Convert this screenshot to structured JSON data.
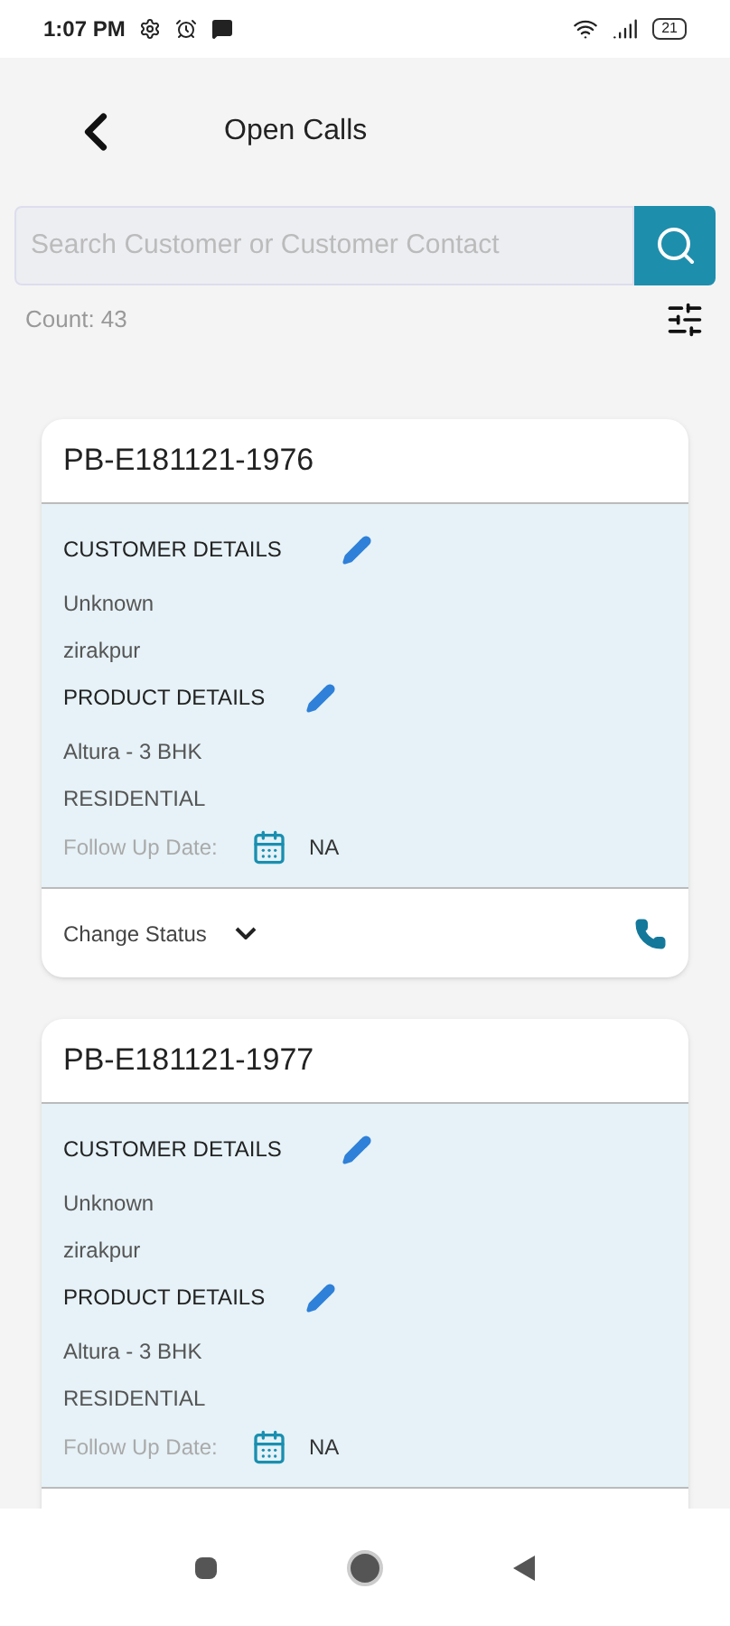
{
  "status_bar": {
    "time": "1:07 PM",
    "battery": "21"
  },
  "header": {
    "title": "Open Calls"
  },
  "search": {
    "placeholder": "Search Customer or Customer Contact"
  },
  "count": "Count: 43",
  "calls": [
    {
      "id": "PB-E181121-1976",
      "customer_heading": "CUSTOMER DETAILS",
      "customer_name": "Unknown",
      "customer_city": "zirakpur",
      "product_heading": "PRODUCT DETAILS",
      "product_name": "Altura - 3 BHK",
      "product_type": "RESIDENTIAL",
      "follow_up_label": "Follow Up Date:",
      "follow_up_value": "NA",
      "status_label": "Change Status"
    },
    {
      "id": "PB-E181121-1977",
      "customer_heading": "CUSTOMER DETAILS",
      "customer_name": "Unknown",
      "customer_city": "zirakpur",
      "product_heading": "PRODUCT DETAILS",
      "product_name": "Altura - 3 BHK",
      "product_type": "RESIDENTIAL",
      "follow_up_label": "Follow Up Date:",
      "follow_up_value": "NA"
    }
  ]
}
